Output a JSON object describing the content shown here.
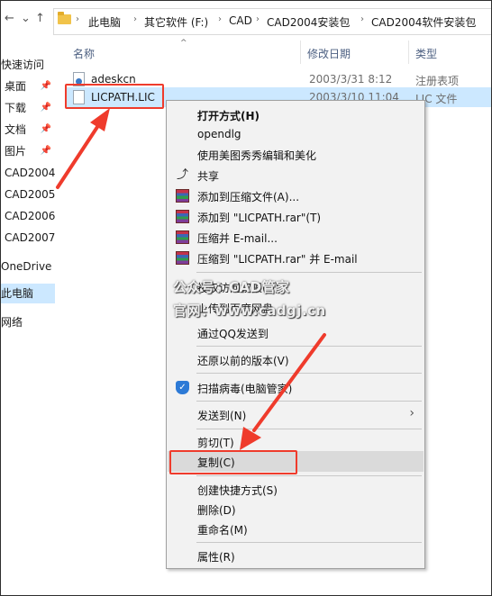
{
  "breadcrumb": [
    "此电脑",
    "其它软件 (F:)",
    "CAD",
    "CAD2004安装包",
    "CAD2004软件安装包"
  ],
  "nav_pane": [
    {
      "label": "快速访问",
      "pinned": false
    },
    {
      "label": "桌面",
      "pinned": true
    },
    {
      "label": "下载",
      "pinned": true
    },
    {
      "label": "文档",
      "pinned": true
    },
    {
      "label": "图片",
      "pinned": true
    },
    {
      "label": "CAD2004",
      "pinned": false
    },
    {
      "label": "CAD2005",
      "pinned": false
    },
    {
      "label": "CAD2006",
      "pinned": false
    },
    {
      "label": "CAD2007",
      "pinned": false
    },
    {
      "label": "OneDrive",
      "pinned": false
    },
    {
      "label": "此电脑",
      "pinned": false
    },
    {
      "label": "网络",
      "pinned": false
    }
  ],
  "columns": {
    "name": "名称",
    "date": "修改日期",
    "type": "类型"
  },
  "files": [
    {
      "name": "adeskcn",
      "date": "2003/3/31 8:12",
      "type": "注册表项",
      "icon": "registry-icon"
    },
    {
      "name": "LICPATH.LIC",
      "date": "2003/3/10 11:04",
      "type": "LIC 文件",
      "icon": "file-icon"
    }
  ],
  "context_menu": [
    {
      "label": "打开方式(H)",
      "bold": true,
      "icon": ""
    },
    {
      "label": "opendlg",
      "bold": false,
      "icon": ""
    },
    {
      "label": "使用美图秀秀编辑和美化",
      "bold": false,
      "icon": ""
    },
    {
      "label": "共享",
      "bold": false,
      "icon": "share-icon"
    },
    {
      "label": "添加到压缩文件(A)...",
      "bold": false,
      "icon": "winrar-icon"
    },
    {
      "label": "添加到 \"LICPATH.rar\"(T)",
      "bold": false,
      "icon": "winrar-icon"
    },
    {
      "label": "压缩并 E-mail...",
      "bold": false,
      "icon": "winrar-icon"
    },
    {
      "label": "压缩到 \"LICPATH.rar\" 并 E-mail",
      "bold": false,
      "icon": "winrar-icon"
    },
    {
      "label": "授权访问权限(G)",
      "bold": false,
      "icon": ""
    },
    {
      "label": "上传到百度网盘",
      "bold": false,
      "icon": ""
    },
    {
      "label": "通过QQ发送到",
      "bold": false,
      "icon": ""
    },
    {
      "label": "还原以前的版本(V)",
      "bold": false,
      "icon": ""
    },
    {
      "label": "扫描病毒(电脑管家)",
      "bold": false,
      "icon": "shield-icon"
    },
    {
      "label": "发送到(N)",
      "bold": false,
      "icon": ""
    },
    {
      "label": "剪切(T)",
      "bold": false,
      "icon": ""
    },
    {
      "label": "复制(C)",
      "bold": false,
      "icon": ""
    },
    {
      "label": "创建快捷方式(S)",
      "bold": false,
      "icon": ""
    },
    {
      "label": "删除(D)",
      "bold": false,
      "icon": ""
    },
    {
      "label": "重命名(M)",
      "bold": false,
      "icon": ""
    },
    {
      "label": "属性(R)",
      "bold": false,
      "icon": ""
    }
  ],
  "watermark": {
    "line1": "公众号：CAD管家",
    "line2": "官网：www.cadgj.cn"
  },
  "colors": {
    "selection": "#cce8ff",
    "highlight_box": "#ef3b2c",
    "menu_bg": "#f2f2f2"
  }
}
